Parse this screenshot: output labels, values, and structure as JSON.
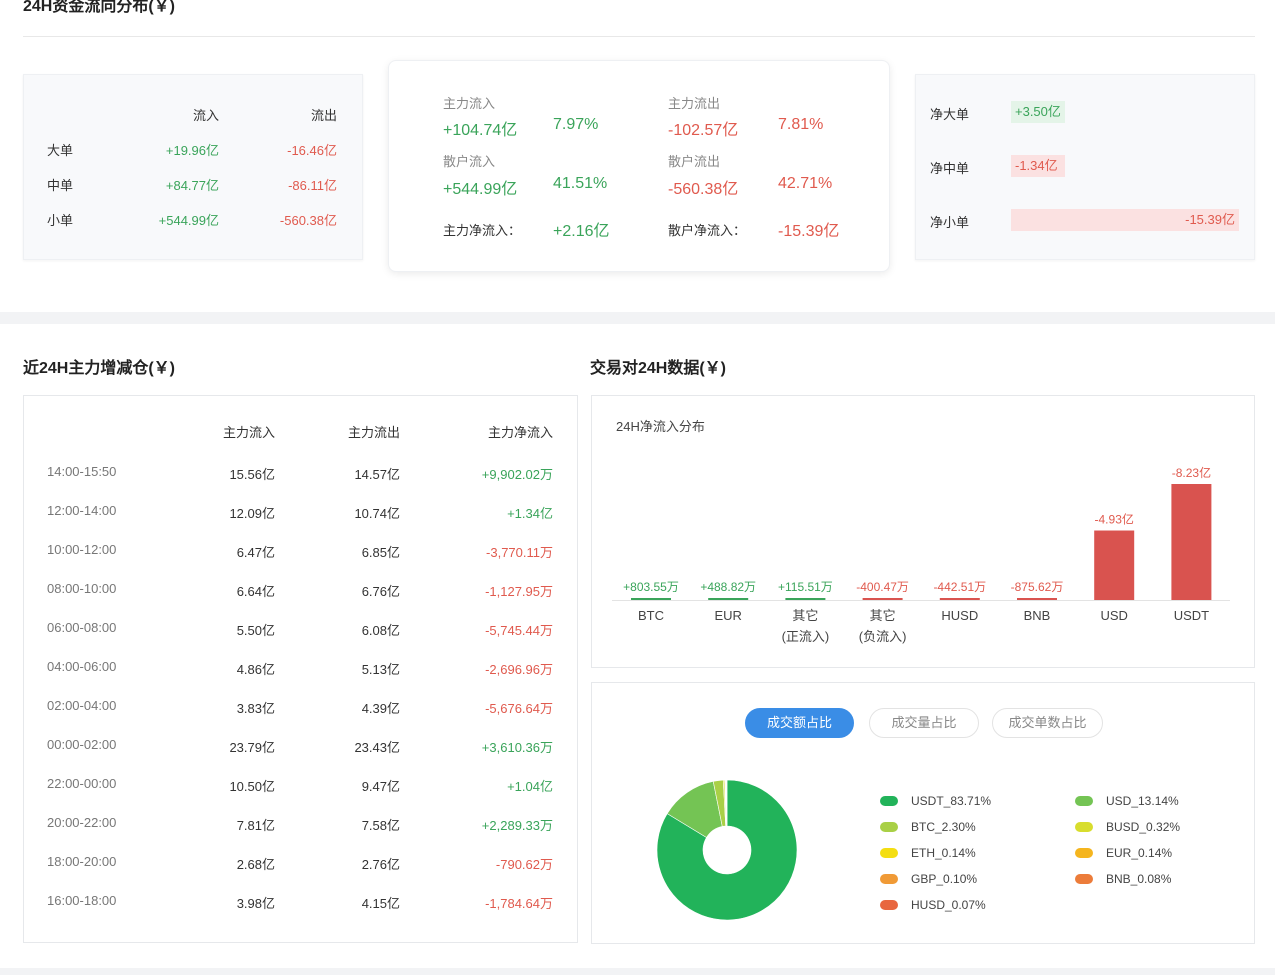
{
  "top": {
    "title": "24H资金流向分布(￥)",
    "card_a": {
      "headers": [
        "",
        "流入",
        "流出"
      ],
      "rows": [
        {
          "label": "大单",
          "in": "+19.96亿",
          "out": "-16.46亿"
        },
        {
          "label": "中单",
          "in": "+84.77亿",
          "out": "-86.11亿"
        },
        {
          "label": "小单",
          "in": "+544.99亿",
          "out": "-560.38亿"
        }
      ]
    },
    "card_b": {
      "main_in_label": "主力流入",
      "main_in_value": "+104.74亿",
      "main_in_pct": "7.97%",
      "main_out_label": "主力流出",
      "main_out_value": "-102.57亿",
      "main_out_pct": "7.81%",
      "retail_in_label": "散户流入",
      "retail_in_value": "+544.99亿",
      "retail_in_pct": "41.51%",
      "retail_out_label": "散户流出",
      "retail_out_value": "-560.38亿",
      "retail_out_pct": "42.71%",
      "main_net_label": "主力净流入：",
      "main_net_value": "+2.16亿",
      "retail_net_label": "散户净流入：",
      "retail_net_value": "-15.39亿"
    },
    "card_c": {
      "items": [
        {
          "label": "净大单",
          "value": "+3.50亿",
          "amount": 3.5
        },
        {
          "label": "净中单",
          "value": "-1.34亿",
          "amount": -1.34
        },
        {
          "label": "净小单",
          "value": "-15.39亿",
          "amount": -15.39
        }
      ]
    }
  },
  "main_position": {
    "title": "近24H主力增减仓(￥)",
    "headers": [
      "主力流入",
      "主力流出",
      "主力净流入"
    ],
    "rows": [
      {
        "time": "14:00-15:50",
        "in": "15.56亿",
        "out": "14.57亿",
        "net": "+9,902.02万"
      },
      {
        "time": "12:00-14:00",
        "in": "12.09亿",
        "out": "10.74亿",
        "net": "+1.34亿"
      },
      {
        "time": "10:00-12:00",
        "in": "6.47亿",
        "out": "6.85亿",
        "net": "-3,770.11万"
      },
      {
        "time": "08:00-10:00",
        "in": "6.64亿",
        "out": "6.76亿",
        "net": "-1,127.95万"
      },
      {
        "time": "06:00-08:00",
        "in": "5.50亿",
        "out": "6.08亿",
        "net": "-5,745.44万"
      },
      {
        "time": "04:00-06:00",
        "in": "4.86亿",
        "out": "5.13亿",
        "net": "-2,696.96万"
      },
      {
        "time": "02:00-04:00",
        "in": "3.83亿",
        "out": "4.39亿",
        "net": "-5,676.64万"
      },
      {
        "time": "00:00-02:00",
        "in": "23.79亿",
        "out": "23.43亿",
        "net": "+3,610.36万"
      },
      {
        "time": "22:00-00:00",
        "in": "10.50亿",
        "out": "9.47亿",
        "net": "+1.04亿"
      },
      {
        "time": "20:00-22:00",
        "in": "7.81亿",
        "out": "7.58亿",
        "net": "+2,289.33万"
      },
      {
        "time": "18:00-20:00",
        "in": "2.68亿",
        "out": "2.76亿",
        "net": "-790.62万"
      },
      {
        "time": "16:00-18:00",
        "in": "3.98亿",
        "out": "4.15亿",
        "net": "-1,784.64万"
      }
    ]
  },
  "pairs": {
    "title": "交易对24H数据(￥)",
    "tabs": [
      "成交额占比",
      "成交量占比",
      "成交单数占比"
    ],
    "active_tab": 0
  },
  "chart_data": [
    {
      "type": "bar",
      "title": "24H净流入分布",
      "categories": [
        "BTC",
        "EUR",
        "其它\n(正流入)",
        "其它\n(负流入)",
        "HUSD",
        "BNB",
        "USD",
        "USDT"
      ],
      "values": [
        0.0803,
        0.0489,
        0.0116,
        -0.04,
        -0.0443,
        -0.0876,
        -4.93,
        -8.23
      ],
      "labels": [
        "+803.55万",
        "+488.82万",
        "+115.51万",
        "-400.47万",
        "-442.51万",
        "-875.62万",
        "-4.93亿",
        "-8.23亿"
      ],
      "unit": "亿",
      "note_bar_height": "bars drawn by absolute value; green positive, red negative"
    },
    {
      "type": "pie",
      "labels": [
        "USDT_83.71%",
        "USD_13.14%",
        "BTC_2.30%",
        "BUSD_0.32%",
        "ETH_0.14%",
        "EUR_0.14%",
        "GBP_0.10%",
        "BNB_0.08%",
        "HUSD_0.07%"
      ],
      "values": [
        83.71,
        13.14,
        2.3,
        0.32,
        0.14,
        0.14,
        0.1,
        0.08,
        0.07
      ],
      "colors": [
        "#22b35a",
        "#74c454",
        "#a9d046",
        "#d8dd2e",
        "#f4de12",
        "#f5b51e",
        "#f09a36",
        "#ec7c3a",
        "#e8663f"
      ]
    }
  ],
  "colors": {
    "positive": "#3aa45a",
    "negative": "#e05a4e",
    "accent": "#3a8de6"
  }
}
